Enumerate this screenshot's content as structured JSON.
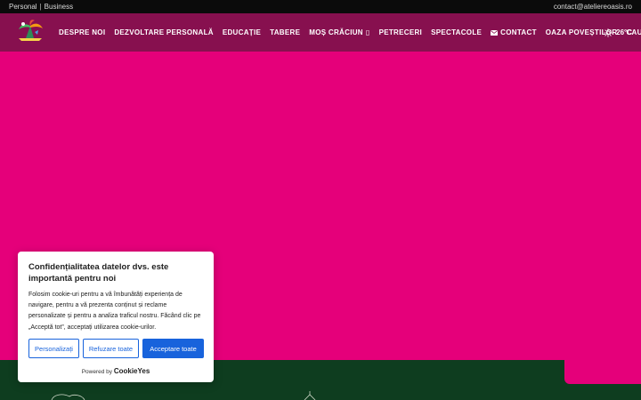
{
  "topbar": {
    "left_a": "Personal",
    "separator": "|",
    "left_b": "Business",
    "email": "contact@ateliereoasis.ro"
  },
  "nav": {
    "items": [
      {
        "label": "DESPRE NOI"
      },
      {
        "label": "DEZVOLTARE PERSONALĂ"
      },
      {
        "label": "EDUCAȚIE"
      },
      {
        "label": "TABERE"
      },
      {
        "label": "MOȘ CRĂCIUN",
        "suffix": "▯"
      },
      {
        "label": "PETRECERI"
      },
      {
        "label": "SPECTACOLE"
      },
      {
        "label": "CONTACT",
        "icon": "mail-icon"
      },
      {
        "label": "OAZA POVEȘTILOR"
      },
      {
        "label": "CAUTA"
      }
    ],
    "weather": {
      "icon": "sun-icon",
      "temperature": "26°C"
    }
  },
  "colors": {
    "topbar_bg": "#0b0b0b",
    "nav_bg": "#87104f",
    "hero_bg": "#e5007a",
    "footer_bg": "#0e3d1f",
    "cookie_accent": "#1863dc"
  },
  "cookie": {
    "title": "Confidențialitatea datelor dvs. este importantă pentru noi",
    "body": "Folosim cookie-uri pentru a vă îmbunătăți experiența de navigare, pentru a vă prezenta conținut și reclame personalizate și pentru a analiza traficul nostru. Făcând clic pe „Acceptă tot”, acceptați utilizarea cookie-urilor.",
    "buttons": {
      "customize": "Personalizați",
      "reject": "Refuzare toate",
      "accept": "Acceptare toate"
    },
    "powered_prefix": "Powered by",
    "powered_brand": "CookieYes"
  }
}
